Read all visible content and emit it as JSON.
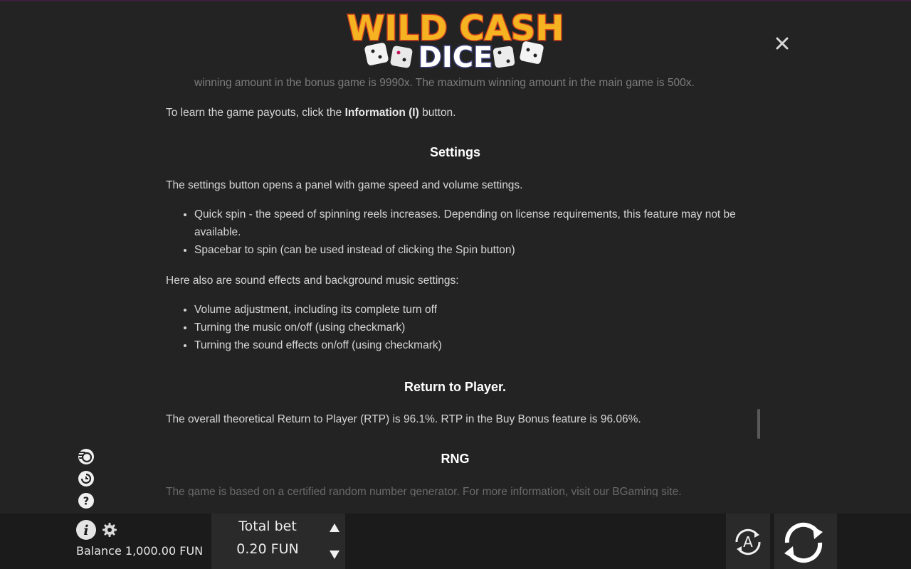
{
  "logo": {
    "line1": "WILD CASH",
    "line2": "DICE"
  },
  "colors": {
    "background": "#232323",
    "logo_fill": "#f5b321",
    "logo_stroke": "#d2431f",
    "bar": "#1b1b1b",
    "panel": "#2a2a2a"
  },
  "rules": {
    "faded_top": "winning amount in the bonus game is 9990x. The maximum winning amount in the main game is 500x.",
    "learn_prefix": "To learn the game payouts, click the ",
    "learn_bold": "Information (I)",
    "learn_suffix": " button.",
    "settings_heading": "Settings",
    "settings_intro": "The settings button opens a panel with game speed and volume settings.",
    "settings_list": [
      "Quick spin - the speed of spinning reels increases. Depending on license requirements, this feature may not be available.",
      "Spacebar to spin (can be used instead of clicking the Spin button)"
    ],
    "sound_intro": "Here also are sound effects and background music settings:",
    "sound_list": [
      "Volume adjustment, including its complete turn off",
      "Turning the music on/off (using checkmark)",
      "Turning the sound effects on/off (using checkmark)"
    ],
    "rtp_heading": "Return to Player.",
    "rtp_text": "The overall theoretical Return to Player (RTP) is 96.1%. RTP in the Buy Bonus feature is 96.06%.",
    "rng_heading": "RNG",
    "faded_bottom": "The game is based on a certified random number generator. For more information, visit our BGaming site."
  },
  "icons": {
    "close": "close-icon",
    "quick_spin": "quick-spin-icon",
    "history": "history-icon",
    "help": "help-icon",
    "info": "info-icon",
    "settings": "gear-icon",
    "bet_up": "arrow-up-icon",
    "bet_down": "arrow-down-icon",
    "autoplay": "autoplay-icon",
    "spin": "spin-icon"
  },
  "footer": {
    "balance": "Balance 1,000.00 FUN",
    "total_bet_label": "Total bet",
    "total_bet_value": "0.20 FUN",
    "autoplay_letter": "A"
  }
}
